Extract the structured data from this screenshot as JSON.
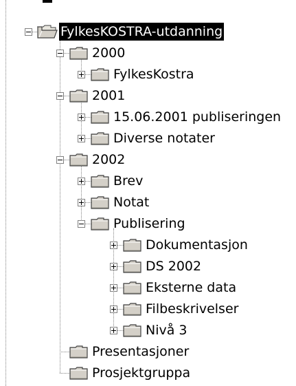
{
  "tree": {
    "nodes": [
      {
        "label": "FylkesKOSTRA-utdanning",
        "level": 0,
        "expander": "minus",
        "selected": true,
        "open": true,
        "last": false
      },
      {
        "label": "2000",
        "level": 1,
        "expander": "minus",
        "last": false
      },
      {
        "label": "FylkesKostra",
        "level": 2,
        "expander": "plus",
        "last": true
      },
      {
        "label": "2001",
        "level": 1,
        "expander": "minus",
        "last": false
      },
      {
        "label": "15.06.2001 publiseringen",
        "level": 2,
        "expander": "plus",
        "last": false
      },
      {
        "label": "Diverse notater",
        "level": 2,
        "expander": "plus",
        "last": true
      },
      {
        "label": "2002",
        "level": 1,
        "expander": "minus",
        "last": false
      },
      {
        "label": "Brev",
        "level": 2,
        "expander": "plus",
        "last": false
      },
      {
        "label": "Notat",
        "level": 2,
        "expander": "plus",
        "last": false
      },
      {
        "label": "Publisering",
        "level": 2,
        "expander": "minus",
        "last": true
      },
      {
        "label": "Dokumentasjon",
        "level": 3,
        "expander": "plus",
        "last": false
      },
      {
        "label": "DS 2002",
        "level": 3,
        "expander": "plus",
        "last": false
      },
      {
        "label": "Eksterne data",
        "level": 3,
        "expander": "plus",
        "last": false
      },
      {
        "label": "Filbeskrivelser",
        "level": 3,
        "expander": "plus",
        "last": false
      },
      {
        "label": "Nivå 3",
        "level": 3,
        "expander": "plus",
        "last": true
      },
      {
        "label": "Presentasjoner",
        "level": 1,
        "expander": "none",
        "last": false
      },
      {
        "label": "Prosjektgruppa",
        "level": 1,
        "expander": "none",
        "last": true
      }
    ]
  },
  "colors": {
    "selected_bg": "#000000",
    "selected_fg": "#ffffff",
    "folder_fill": "#d4d0c8",
    "folder_edge": "#404040",
    "tree_line": "#808080"
  },
  "icons": {
    "expander_minus": "minus-box-icon",
    "expander_plus": "plus-box-icon",
    "folder_closed": "folder-icon",
    "folder_open": "folder-open-icon"
  }
}
